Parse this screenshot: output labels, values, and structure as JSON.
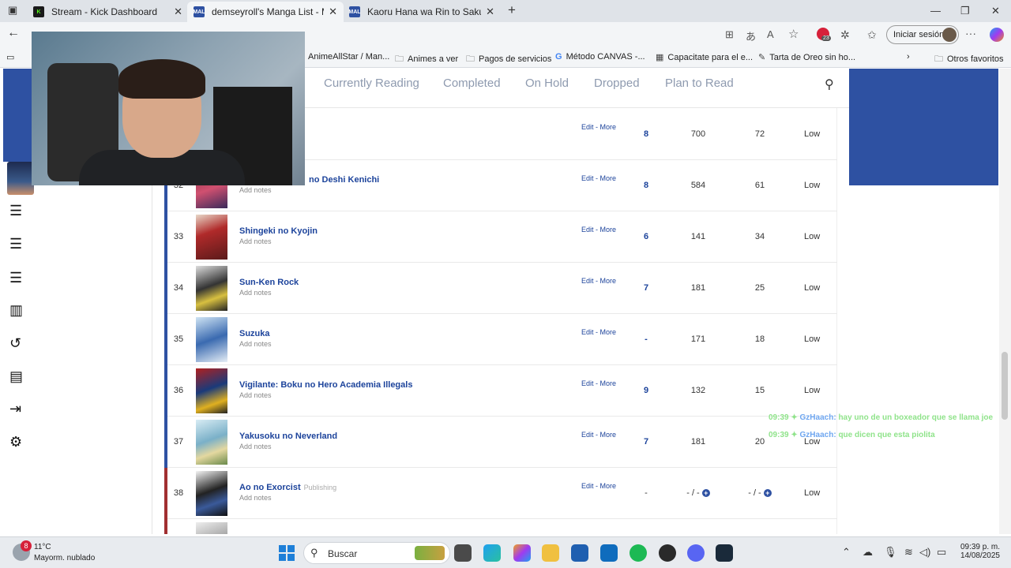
{
  "browser": {
    "tabs": [
      {
        "title": "Stream - Kick Dashboard",
        "favicon": "kick-icon"
      },
      {
        "title": "demseyroll's Manga List - MyAnim",
        "favicon": "mal-icon"
      },
      {
        "title": "Kaoru Hana wa Rin to Saku (The F",
        "favicon": "mal-icon"
      }
    ],
    "signin_label": "Iniciar sesión",
    "extension_badge": "23",
    "bookmarks": [
      {
        "label": "AnimeAllStar / Man...",
        "icon": "page-icon"
      },
      {
        "label": "Animes a ver",
        "icon": "folder-icon"
      },
      {
        "label": "Pagos de servicios",
        "icon": "folder-icon"
      },
      {
        "label": "Método CANVAS -...",
        "icon": "google-icon"
      },
      {
        "label": "Capacitate para el e...",
        "icon": "page-icon"
      },
      {
        "label": "Tarta de Oreo sin ho...",
        "icon": "page-icon"
      },
      {
        "label": "Otros favoritos",
        "icon": "folder-icon"
      }
    ]
  },
  "list_header": {
    "tabs": [
      "Currently Reading",
      "Completed",
      "On Hold",
      "Dropped",
      "Plan to Read"
    ]
  },
  "rows": [
    {
      "num": "",
      "title": "",
      "notes": "",
      "edit": "Edit - More",
      "score": "8",
      "chapters": "700",
      "volumes": "72",
      "priority": "Low",
      "status": "reading",
      "publishing": ""
    },
    {
      "num": "32",
      "title": "no Deshi Kenichi",
      "notes": "Add notes",
      "edit": "Edit - More",
      "score": "8",
      "chapters": "584",
      "volumes": "61",
      "priority": "Low",
      "status": "reading",
      "publishing": ""
    },
    {
      "num": "33",
      "title": "Shingeki no Kyojin",
      "notes": "Add notes",
      "edit": "Edit - More",
      "score": "6",
      "chapters": "141",
      "volumes": "34",
      "priority": "Low",
      "status": "reading",
      "publishing": ""
    },
    {
      "num": "34",
      "title": "Sun-Ken Rock",
      "notes": "Add notes",
      "edit": "Edit - More",
      "score": "7",
      "chapters": "181",
      "volumes": "25",
      "priority": "Low",
      "status": "reading",
      "publishing": ""
    },
    {
      "num": "35",
      "title": "Suzuka",
      "notes": "Add notes",
      "edit": "Edit - More",
      "score": "-",
      "chapters": "171",
      "volumes": "18",
      "priority": "Low",
      "status": "reading",
      "publishing": ""
    },
    {
      "num": "36",
      "title": "Vigilante: Boku no Hero Academia Illegals",
      "notes": "Add notes",
      "edit": "Edit - More",
      "score": "9",
      "chapters": "132",
      "volumes": "15",
      "priority": "Low",
      "status": "reading",
      "publishing": ""
    },
    {
      "num": "37",
      "title": "Yakusoku no Neverland",
      "notes": "Add notes",
      "edit": "Edit - More",
      "score": "7",
      "chapters": "181",
      "volumes": "20",
      "priority": "Low",
      "status": "reading",
      "publishing": ""
    },
    {
      "num": "38",
      "title": "Ao no Exorcist",
      "notes": "Add notes",
      "edit": "Edit - More",
      "score": "-",
      "chapters": "- / -",
      "volumes": "- / -",
      "priority": "Low",
      "status": "publishing",
      "publishing": "Publishing"
    }
  ],
  "chat": [
    {
      "time": "09:39",
      "user": "GzHaach:",
      "message": "hay uno de un boxeador que se llama joe"
    },
    {
      "time": "09:39",
      "user": "GzHaach:",
      "message": "que dicen que esta piolita"
    }
  ],
  "taskbar": {
    "weather_badge": "8",
    "weather_temp": "11°C",
    "weather_desc": "Mayorm. nublado",
    "search_label": "Buscar",
    "time": "09:39 p. m.",
    "date": "14/08/2025"
  },
  "colors": {
    "mal_blue": "#2e51a2",
    "publishing_red": "#a12f31",
    "title_link": "#1c439b"
  }
}
